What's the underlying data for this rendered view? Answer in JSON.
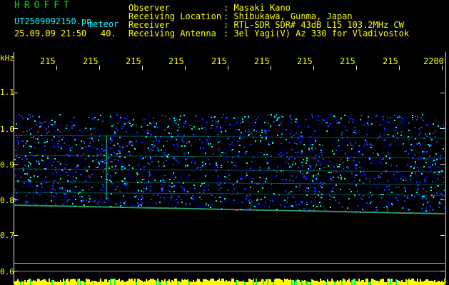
{
  "header": {
    "title": "HROFFT",
    "filename": "UT2509092150.pn",
    "filename_suffix": "meteor",
    "datetime": "25.09.09 21:50",
    "count": "40."
  },
  "info": [
    {
      "label": "Observer",
      "value": ": Masaki Kano"
    },
    {
      "label": "Receiving Location",
      "value": ": Shibukawa, Gunma, Japan"
    },
    {
      "label": "Receiver",
      "value": ": RTL-SDR SDR# 43dB L15 103.2MHz CW"
    },
    {
      "label": "Receiving Antenna",
      "value": ": 3el Yagi(V) Az 330 for Vladivostok"
    }
  ],
  "axis": {
    "y_unit": "kHz",
    "y_ticks": [
      "1.1",
      "1.0",
      "0.9",
      "0.8",
      "0.7",
      "0.6"
    ],
    "x_ticks": [
      "215",
      "215",
      "215",
      "215",
      "215",
      "215",
      "215",
      "215",
      "215",
      "2200"
    ]
  },
  "colors": {
    "background": "#000000",
    "text_primary": "#ffff00",
    "title": "#00e000",
    "numeral": "#00ffff",
    "waterfall_low": "#00008b",
    "waterfall_mid": "#00ffcc",
    "waterfall_high": "#ff3030"
  }
}
